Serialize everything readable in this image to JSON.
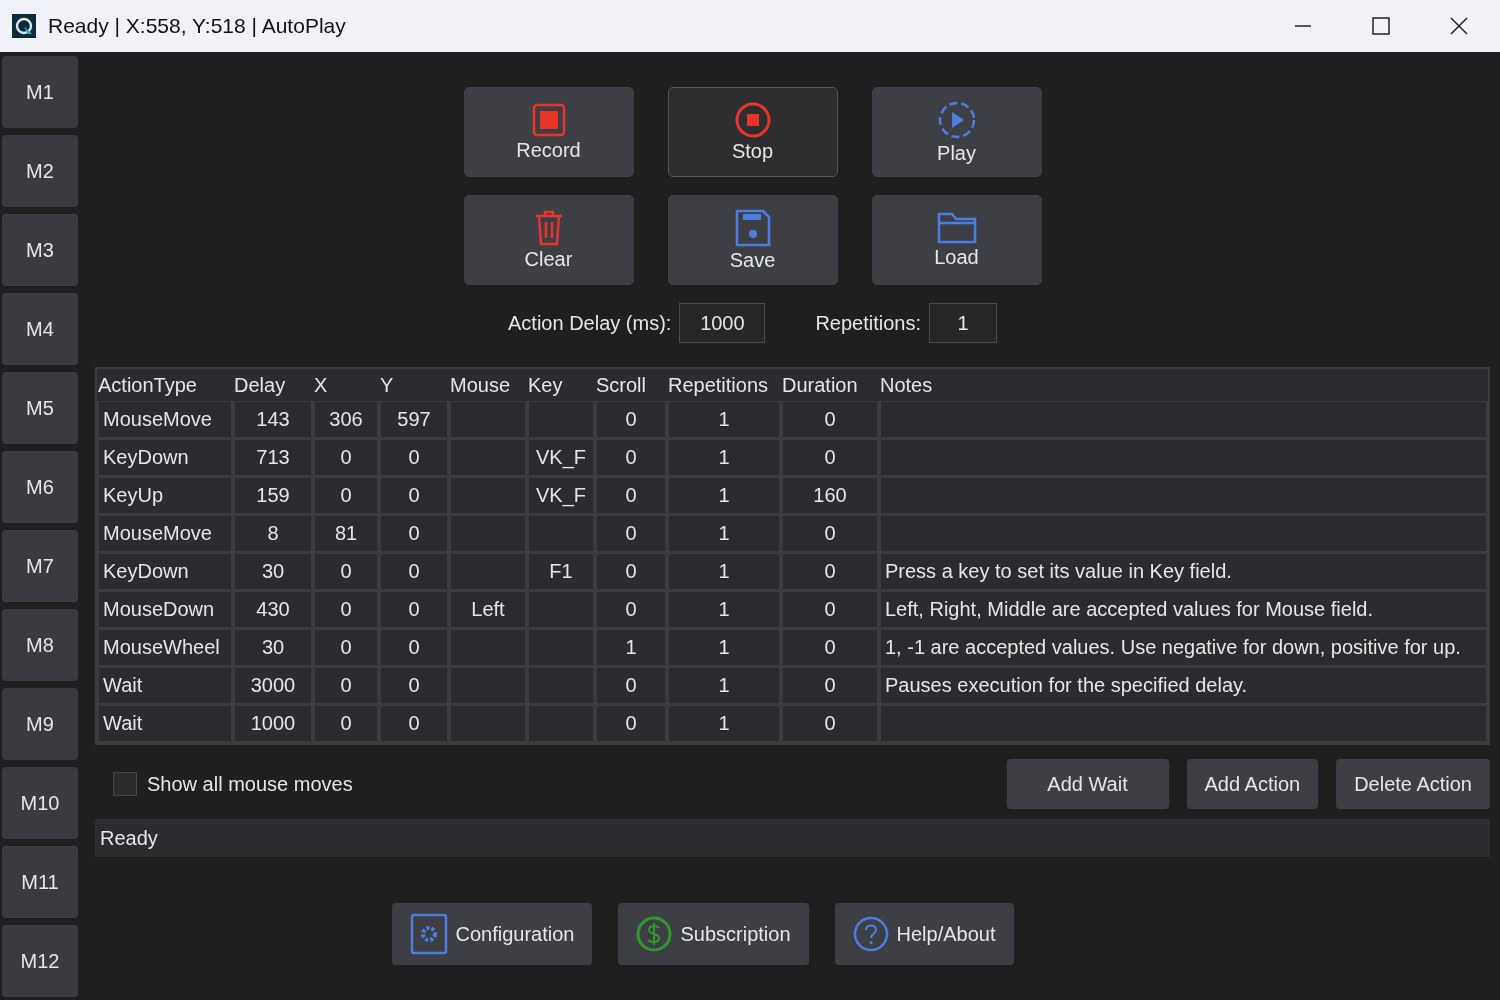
{
  "window": {
    "title": "Ready | X:558, Y:518 | AutoPlay"
  },
  "sidebar": {
    "items": [
      {
        "label": "M1"
      },
      {
        "label": "M2"
      },
      {
        "label": "M3"
      },
      {
        "label": "M4"
      },
      {
        "label": "M5"
      },
      {
        "label": "M6"
      },
      {
        "label": "M7"
      },
      {
        "label": "M8"
      },
      {
        "label": "M9"
      },
      {
        "label": "M10"
      },
      {
        "label": "M11"
      },
      {
        "label": "M12"
      }
    ]
  },
  "toolbar": [
    {
      "label": "Record",
      "kind": "record",
      "active": false
    },
    {
      "label": "Stop",
      "kind": "stop",
      "active": true
    },
    {
      "label": "Play",
      "kind": "play",
      "active": false
    },
    {
      "label": "Clear",
      "kind": "clear",
      "active": false
    },
    {
      "label": "Save",
      "kind": "save",
      "active": false
    },
    {
      "label": "Load",
      "kind": "load",
      "active": false
    }
  ],
  "settings": [
    {
      "label": "Action Delay (ms):",
      "value": "1000"
    },
    {
      "label": "Repetitions:",
      "value": "1"
    }
  ],
  "table": {
    "columns": [
      "ActionType",
      "Delay",
      "X",
      "Y",
      "Mouse",
      "Key",
      "Scroll",
      "Repetitions",
      "Duration",
      "Notes"
    ],
    "rows": [
      [
        "MouseMove",
        "143",
        "306",
        "597",
        "",
        "",
        "0",
        "1",
        "0",
        ""
      ],
      [
        "KeyDown",
        "713",
        "0",
        "0",
        "",
        "VK_F",
        "0",
        "1",
        "0",
        ""
      ],
      [
        "KeyUp",
        "159",
        "0",
        "0",
        "",
        "VK_F",
        "0",
        "1",
        "160",
        ""
      ],
      [
        "MouseMove",
        "8",
        "81",
        "0",
        "",
        "",
        "0",
        "1",
        "0",
        ""
      ],
      [
        "KeyDown",
        "30",
        "0",
        "0",
        "",
        "F1",
        "0",
        "1",
        "0",
        "Press a key to set its value in Key field."
      ],
      [
        "MouseDown",
        "430",
        "0",
        "0",
        "Left",
        "",
        "0",
        "1",
        "0",
        "Left, Right, Middle are accepted values for Mouse field."
      ],
      [
        "MouseWheel",
        "30",
        "0",
        "0",
        "",
        "",
        "1",
        "1",
        "0",
        "1, -1 are accepted values. Use negative for down, positive for up."
      ],
      [
        "Wait",
        "3000",
        "0",
        "0",
        "",
        "",
        "0",
        "1",
        "0",
        "Pauses execution for the specified delay."
      ],
      [
        "Wait",
        "1000",
        "0",
        "0",
        "",
        "",
        "0",
        "1",
        "0",
        ""
      ]
    ]
  },
  "show_all_mouse_moves": {
    "label": "Show all mouse moves",
    "checked": false
  },
  "actions": [
    "Add Wait",
    "Add Action",
    "Delete Action"
  ],
  "status_bar": "Ready",
  "footer": [
    {
      "label": "Configuration",
      "kind": "config"
    },
    {
      "label": "Subscription",
      "kind": "subscription"
    },
    {
      "label": "Help/About",
      "kind": "help"
    }
  ]
}
